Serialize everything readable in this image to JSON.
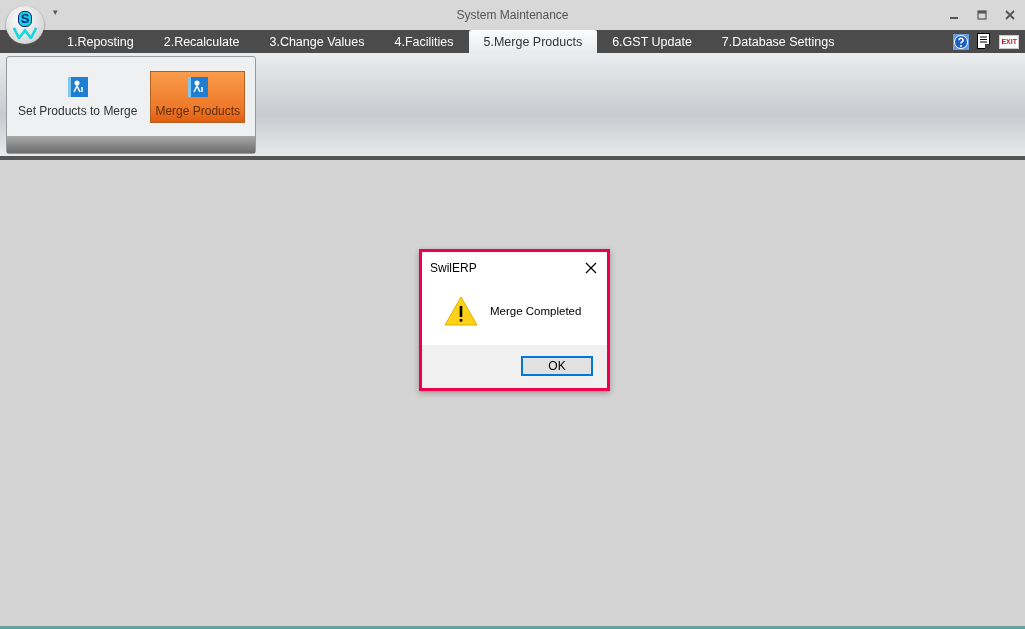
{
  "window": {
    "title": "System Maintenance",
    "logo_letter": "S",
    "quick_access": "▾"
  },
  "tabs": [
    {
      "label": "1.Reposting",
      "selected": false
    },
    {
      "label": "2.Recalculate",
      "selected": false
    },
    {
      "label": "3.Change Values",
      "selected": false
    },
    {
      "label": "4.Facilities",
      "selected": false
    },
    {
      "label": "5.Merge Products",
      "selected": true
    },
    {
      "label": "6.GST Update",
      "selected": false
    },
    {
      "label": "7.Database Settings",
      "selected": false
    }
  ],
  "toolbar_icons": [
    {
      "kind": "help"
    },
    {
      "kind": "document"
    },
    {
      "kind": "exit",
      "label": "EXIT"
    }
  ],
  "ribbon_buttons": [
    {
      "label": "Set Products to Merge",
      "selected": false
    },
    {
      "label": "Merge Products",
      "selected": true
    }
  ],
  "dialog": {
    "title": "SwilERP",
    "message": "Merge Completed",
    "button": "OK"
  }
}
